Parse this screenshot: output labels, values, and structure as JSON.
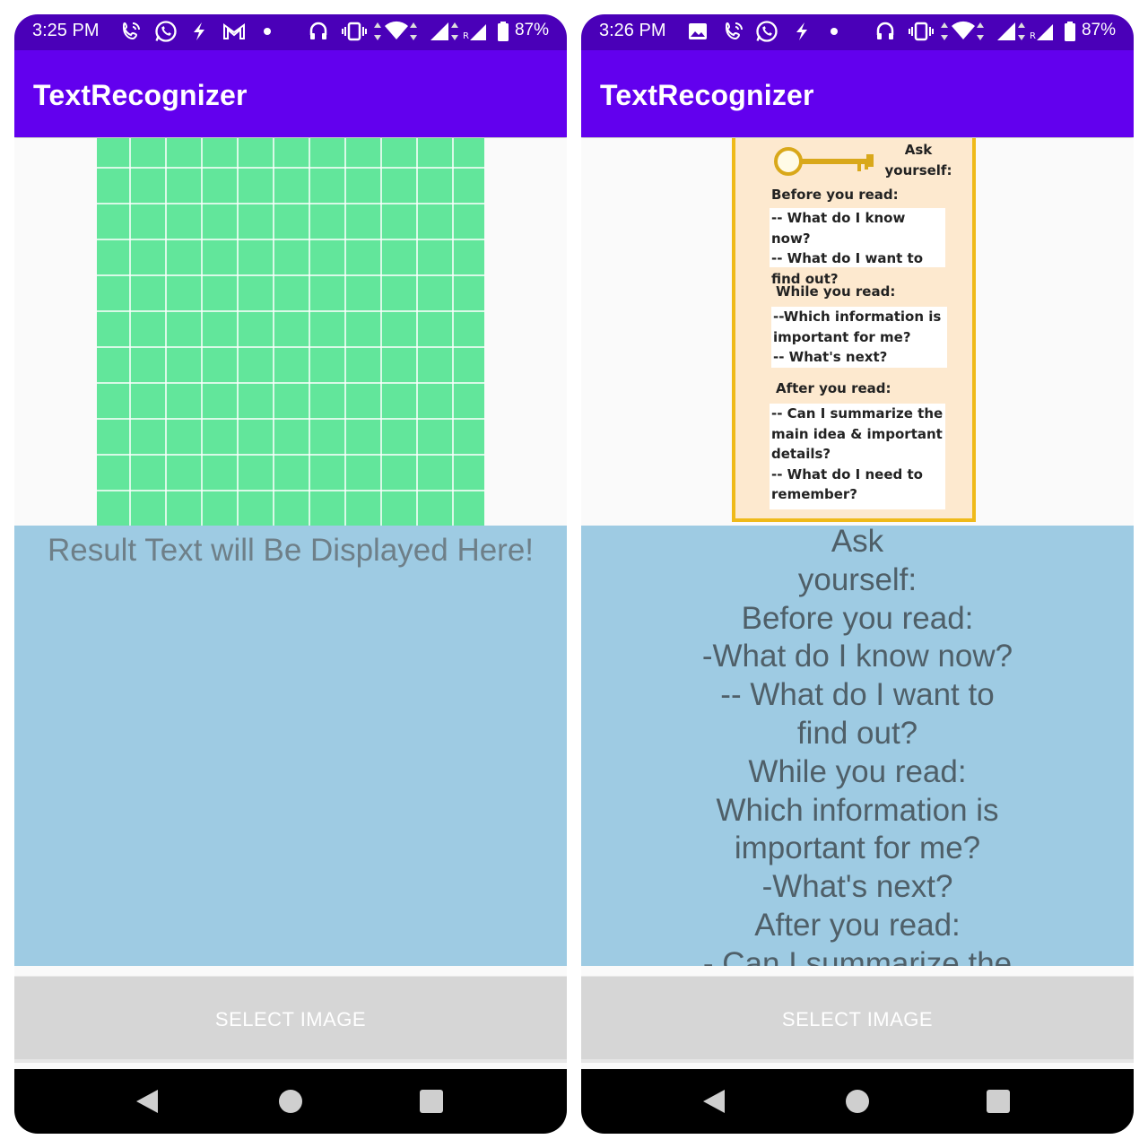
{
  "left": {
    "status": {
      "time": "3:25 PM",
      "battery": "87%"
    },
    "app_bar": {
      "title": "TextRecognizer"
    },
    "result": {
      "placeholder": "Result Text will Be Displayed Here!"
    },
    "button": {
      "label": "SELECT IMAGE"
    }
  },
  "right": {
    "status": {
      "time": "3:26 PM",
      "battery": "87%"
    },
    "app_bar": {
      "title": "TextRecognizer"
    },
    "card": {
      "title": "Ask\nyourself:",
      "before_heading": "Before you read:",
      "before_body": "-- What do I know now?\n-- What do I want to\nfind out?",
      "while_heading": "While you read:",
      "while_body": "--Which information is\nimportant for me?\n-- What's next?",
      "after_heading": "After you read:",
      "after_body": "-- Can I summarize the\nmain idea & important\ndetails?\n-- What do I need to\nremember?"
    },
    "result": {
      "text": "Ask\nyourself:\nBefore you read:\n-What do I know now?\n-- What do I want to\nfind out?\nWhile you read:\nWhich information is\nimportant for me?\n-What's next?\nAfter you read:\n- Can I summarize the"
    },
    "button": {
      "label": "SELECT IMAGE"
    }
  },
  "colors": {
    "status_bar": "#4a00b8",
    "app_bar": "#6200ee",
    "result_bg": "#9ecbe3",
    "grid_image": "#62e69b",
    "button_bg": "#d6d6d6",
    "card_bg": "#fde9cf",
    "card_border": "#efba1a"
  },
  "icons": {
    "status_left": [
      "wifi-calling-icon",
      "whatsapp-icon",
      "messenger-icon",
      "gmail-icon",
      "dot-icon"
    ],
    "status_right_extra": [
      "image-icon"
    ],
    "status_system": [
      "headphones-icon",
      "vibrate-icon",
      "data-arrows-icon",
      "wifi-icon",
      "signal-icon",
      "roaming-signal-icon",
      "battery-icon"
    ],
    "nav": [
      "back-icon",
      "home-icon",
      "recents-icon"
    ]
  }
}
